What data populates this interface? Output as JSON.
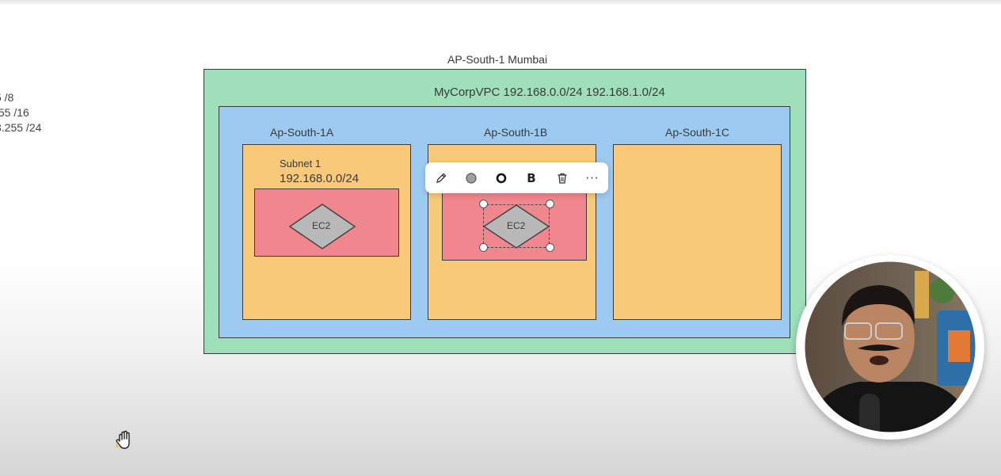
{
  "side_notes": [
    {
      "text": "5  /8"
    },
    {
      "text": ".55 /16"
    },
    {
      "text": "3.255 /24"
    }
  ],
  "region": {
    "label": "AP-South-1 Mumbai"
  },
  "vpc": {
    "label": "MyCorpVPC 192.168.0.0/24 192.168.1.0/24"
  },
  "zones": [
    {
      "label": "Ap-South-1A"
    },
    {
      "label": "Ap-South-1B"
    },
    {
      "label": "Ap-South-1C"
    }
  ],
  "subnet1": {
    "name": "Subnet 1",
    "cidr": "192.168.0.0/24"
  },
  "ec2": [
    {
      "label": "EC2"
    },
    {
      "label": "EC2"
    }
  ],
  "toolbar": {
    "items": [
      "pencil-icon",
      "fill-color-icon",
      "stroke-icon",
      "bold",
      "trash-icon",
      "more-icon"
    ],
    "bold_label": "B",
    "more_label": "···"
  },
  "colors": {
    "region": "#9fe0bb",
    "vpc": "#9dcaf0",
    "availability_zone": "#f9c97a",
    "subnet": "#f0868e",
    "ec2": "#b9b9b9"
  },
  "cursor": {
    "icon": "hand-pan-icon"
  },
  "webcam": {
    "icon": "presenter-webcam"
  }
}
